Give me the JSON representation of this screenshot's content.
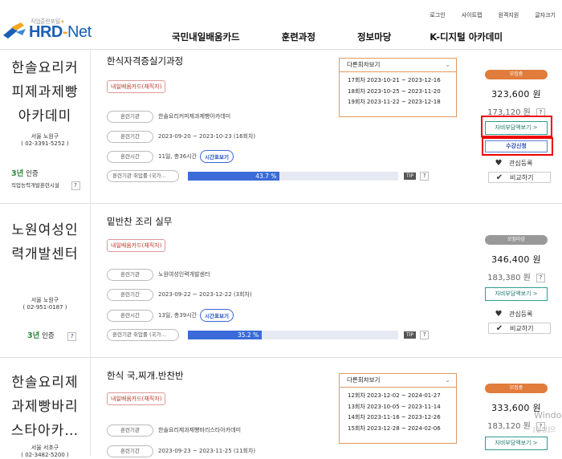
{
  "header": {
    "logo_tag": "직업훈련포털",
    "logo_brand_a": "HRD",
    "logo_brand_dash": "-",
    "logo_brand_b": "Net",
    "util": [
      "로그인",
      "사이트맵",
      "원격지원",
      "글자크기"
    ],
    "gnb": [
      "국민내일배움카드",
      "훈련과정",
      "정보마당",
      "K-디지털 아카데미"
    ]
  },
  "courses": [
    {
      "org_lines": [
        "한솔요리커",
        "피제과제빵",
        "아카데미"
      ],
      "addr1": "서울 노원구",
      "addr2": "( 02-3391-5252 )",
      "cert_num": "3년",
      "cert_label": "인증",
      "cert_sub": "직업능력개발훈련시설",
      "title": "한식자격증실기과정",
      "badge": "내일배움카드(재직자)",
      "inst_label": "훈련기관",
      "inst": "한솔요리커피제과제빵아카데미",
      "period_label": "훈련기간",
      "period": "2023-09-20 ~ 2023-10-23 (16회차)",
      "time_label": "훈련시간",
      "time": "11일, 총36시간",
      "time_btn": "시간표보기",
      "emp_label": "훈련기관 취업률 (국가…",
      "emp_rate_text": "43.7 %",
      "emp_rate": 43.7,
      "tip": "TIP",
      "other_head": "다른회차보기",
      "other": [
        "17회차 2023-10-21 ~ 2023-12-16",
        "18회차 2023-10-25 ~ 2023-11-20",
        "19회차 2023-11-22 ~ 2023-12-18"
      ],
      "status": "모집중",
      "price_total": "323,600 원",
      "price_self": "173,120 원",
      "support_btn": "자비부담액보기 >",
      "apply_btn": "수강신청",
      "fav": "관심등록",
      "compare": "비교하기"
    },
    {
      "org_lines": [
        "노원여성인",
        "력개발센터"
      ],
      "addr1": "서울 노원구",
      "addr2": "( 02-951-0187 )",
      "cert_num": "3년",
      "cert_label": "인증",
      "title": "밑반찬 조리 실무",
      "badge": "내일배움카드(재직자)",
      "inst_label": "훈련기관",
      "inst": "노원여성인력개발센터",
      "period_label": "훈련기간",
      "period": "2023-09-22 ~ 2023-12-22 (3회차)",
      "time_label": "훈련시간",
      "time": "13일, 총39시간",
      "time_btn": "시간표보기",
      "emp_label": "훈련기관 취업률 (국가…",
      "emp_rate_text": "35.2 %",
      "emp_rate": 35.2,
      "tip": "TIP",
      "status": "모집마감",
      "price_total": "346,400 원",
      "price_self": "183,380 원",
      "support_btn": "자비부담액보기 >",
      "fav": "관심등록",
      "compare": "비교하기"
    },
    {
      "org_lines": [
        "한솔요리제",
        "과제빵바리",
        "스타아카…"
      ],
      "addr1": "서울 서초구",
      "addr2": "( 02-3482-5200 )",
      "title": "한식 국,찌개.반찬반",
      "badge": "내일배움카드(재직자)",
      "inst_label": "훈련기관",
      "inst": "한솔요리제과제빵바리스타아카데미",
      "period_label": "훈련기간",
      "period": "2023-09-23 ~ 2023-11-25 (11회차)",
      "other_head": "다른회차보기",
      "other": [
        "12회차 2023-12-02 ~ 2024-01-27",
        "13회차 2023-10-05 ~ 2023-11-14",
        "14회차 2023-11-16 ~ 2023-12-26",
        "15회차 2023-12-28 ~ 2024-02-06"
      ],
      "status": "모집중",
      "price_total": "333,600 원",
      "price_self": "183,120 원",
      "support_btn": "자비부담액보기 >"
    }
  ],
  "windows_watermark": "Windo",
  "windows_watermark2": "[설정]으"
}
